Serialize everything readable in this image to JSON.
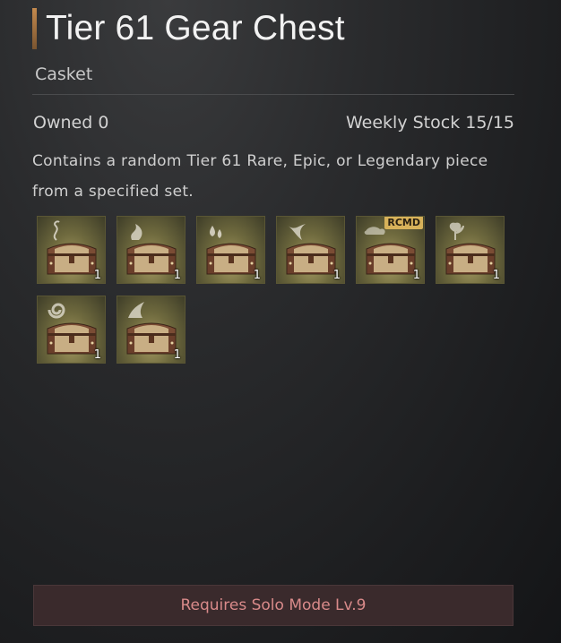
{
  "header": {
    "title": "Tier 61 Gear Chest",
    "subtitle": "Casket"
  },
  "info": {
    "owned": "Owned 0",
    "weekly_stock": "Weekly Stock 15/15",
    "description": "Contains a random Tier 61 Rare, Epic, or Legendary piece from a specified set."
  },
  "items": [
    {
      "icon": "smoke-wisp-icon",
      "quantity": "1",
      "badge": ""
    },
    {
      "icon": "flame-swirl-icon",
      "quantity": "1",
      "badge": ""
    },
    {
      "icon": "water-drop-icon",
      "quantity": "1",
      "badge": ""
    },
    {
      "icon": "bird-wing-icon",
      "quantity": "1",
      "badge": ""
    },
    {
      "icon": "mist-cloud-icon",
      "quantity": "1",
      "badge": "RCMD"
    },
    {
      "icon": "leaf-flower-icon",
      "quantity": "1",
      "badge": ""
    },
    {
      "icon": "vortex-swirl-icon",
      "quantity": "1",
      "badge": ""
    },
    {
      "icon": "wind-gust-icon",
      "quantity": "1",
      "badge": ""
    }
  ],
  "footer": {
    "requirement_label": "Requires Solo Mode Lv.9"
  },
  "colors": {
    "accent_bar": "#c48a4e",
    "badge": "#d8b25a",
    "requirement_text": "#d98a8a"
  }
}
